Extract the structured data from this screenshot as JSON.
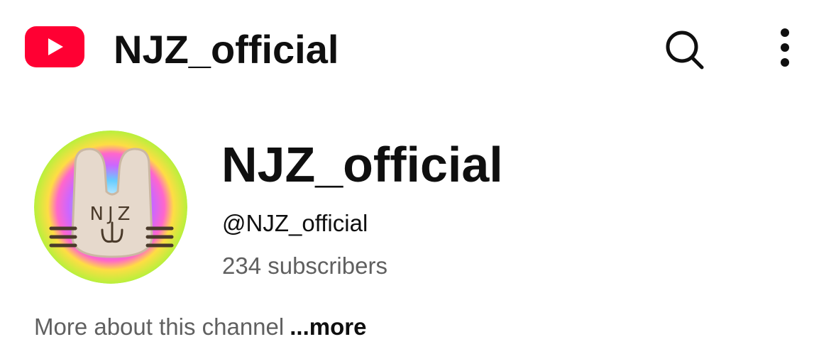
{
  "header": {
    "app_title": "NJZ_official",
    "logo_icon": "youtube-logo-icon",
    "search_icon": "search-icon",
    "more_icon": "more-vertical-icon"
  },
  "channel": {
    "name": "NJZ_official",
    "handle": "@NJZ_official",
    "subscribers": "234 subscribers",
    "avatar_text": "NJZ"
  },
  "description": {
    "text": "More about this channel",
    "more_label": "...more"
  },
  "colors": {
    "brand_red": "#ff0033",
    "text_primary": "#0f0f0f",
    "text_secondary": "#606060"
  }
}
